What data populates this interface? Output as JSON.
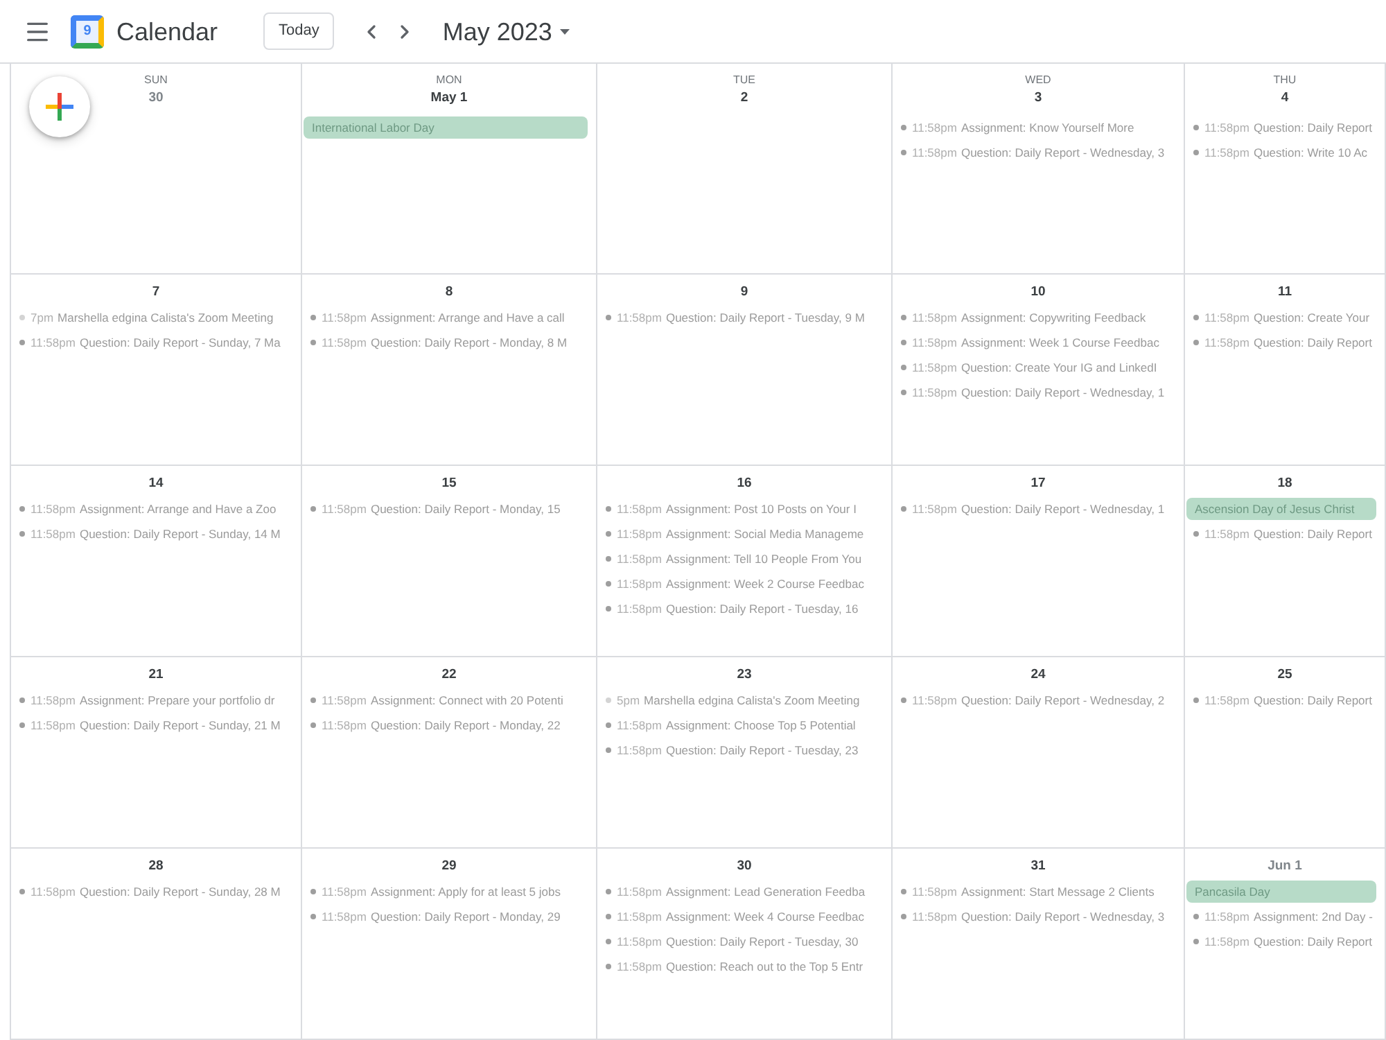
{
  "header": {
    "app_name": "Calendar",
    "logo_text": "9",
    "today_button": "Today",
    "period": "May 2023"
  },
  "weekdays": [
    "SUN",
    "MON",
    "TUE",
    "WED",
    "THU"
  ],
  "weeks": [
    {
      "days": [
        {
          "date": "30",
          "in_month": false
        },
        {
          "date": "May 1",
          "in_month": true,
          "events": [
            {
              "kind": "all_day",
              "title": "International Labor Day"
            }
          ]
        },
        {
          "date": "2",
          "in_month": true
        },
        {
          "date": "3",
          "in_month": true,
          "events": [
            {
              "kind": "timed",
              "time": "11:58pm",
              "title": "Assignment: Know Yourself More",
              "color": "#9e9e9e"
            },
            {
              "kind": "timed",
              "time": "11:58pm",
              "title": "Question: Daily Report - Wednesday, 3",
              "color": "#9e9e9e"
            }
          ]
        },
        {
          "date": "4",
          "in_month": true,
          "events": [
            {
              "kind": "timed",
              "time": "11:58pm",
              "title": "Question: Daily Report",
              "color": "#9e9e9e"
            },
            {
              "kind": "timed",
              "time": "11:58pm",
              "title": "Question: Write 10 Ac",
              "color": "#9e9e9e"
            }
          ]
        }
      ]
    },
    {
      "days": [
        {
          "date": "7",
          "in_month": true,
          "events": [
            {
              "kind": "timed",
              "time": "7pm",
              "title": "Marshella edgina Calista's Zoom Meeting",
              "color": "#d4d4d4"
            },
            {
              "kind": "timed",
              "time": "11:58pm",
              "title": "Question: Daily Report - Sunday, 7 Ma",
              "color": "#9e9e9e"
            }
          ]
        },
        {
          "date": "8",
          "in_month": true,
          "events": [
            {
              "kind": "timed",
              "time": "11:58pm",
              "title": "Assignment: Arrange and Have a call",
              "color": "#9e9e9e"
            },
            {
              "kind": "timed",
              "time": "11:58pm",
              "title": "Question: Daily Report - Monday, 8 M",
              "color": "#9e9e9e"
            }
          ]
        },
        {
          "date": "9",
          "in_month": true,
          "events": [
            {
              "kind": "timed",
              "time": "11:58pm",
              "title": "Question: Daily Report - Tuesday, 9 M",
              "color": "#9e9e9e"
            }
          ]
        },
        {
          "date": "10",
          "in_month": true,
          "events": [
            {
              "kind": "timed",
              "time": "11:58pm",
              "title": "Assignment: Copywriting Feedback",
              "color": "#9e9e9e"
            },
            {
              "kind": "timed",
              "time": "11:58pm",
              "title": "Assignment: Week 1 Course Feedbac",
              "color": "#9e9e9e"
            },
            {
              "kind": "timed",
              "time": "11:58pm",
              "title": "Question: Create Your IG and LinkedI",
              "color": "#9e9e9e"
            },
            {
              "kind": "timed",
              "time": "11:58pm",
              "title": "Question: Daily Report - Wednesday, 1",
              "color": "#9e9e9e"
            }
          ]
        },
        {
          "date": "11",
          "in_month": true,
          "events": [
            {
              "kind": "timed",
              "time": "11:58pm",
              "title": "Question: Create Your",
              "color": "#9e9e9e"
            },
            {
              "kind": "timed",
              "time": "11:58pm",
              "title": "Question: Daily Report",
              "color": "#9e9e9e"
            }
          ]
        }
      ]
    },
    {
      "days": [
        {
          "date": "14",
          "in_month": true,
          "events": [
            {
              "kind": "timed",
              "time": "11:58pm",
              "title": "Assignment: Arrange and Have a Zoo",
              "color": "#9e9e9e"
            },
            {
              "kind": "timed",
              "time": "11:58pm",
              "title": "Question: Daily Report - Sunday, 14 M",
              "color": "#9e9e9e"
            }
          ]
        },
        {
          "date": "15",
          "in_month": true,
          "events": [
            {
              "kind": "timed",
              "time": "11:58pm",
              "title": "Question: Daily Report - Monday, 15",
              "color": "#9e9e9e"
            }
          ]
        },
        {
          "date": "16",
          "in_month": true,
          "events": [
            {
              "kind": "timed",
              "time": "11:58pm",
              "title": "Assignment: Post 10 Posts on Your I",
              "color": "#9e9e9e"
            },
            {
              "kind": "timed",
              "time": "11:58pm",
              "title": "Assignment: Social Media Manageme",
              "color": "#9e9e9e"
            },
            {
              "kind": "timed",
              "time": "11:58pm",
              "title": "Assignment: Tell 10 People From You",
              "color": "#9e9e9e"
            },
            {
              "kind": "timed",
              "time": "11:58pm",
              "title": "Assignment: Week 2 Course Feedbac",
              "color": "#9e9e9e"
            },
            {
              "kind": "timed",
              "time": "11:58pm",
              "title": "Question: Daily Report - Tuesday, 16",
              "color": "#9e9e9e"
            }
          ]
        },
        {
          "date": "17",
          "in_month": true,
          "events": [
            {
              "kind": "timed",
              "time": "11:58pm",
              "title": "Question: Daily Report - Wednesday, 1",
              "color": "#9e9e9e"
            }
          ]
        },
        {
          "date": "18",
          "in_month": true,
          "events": [
            {
              "kind": "all_day",
              "title": "Ascension Day of Jesus Christ"
            },
            {
              "kind": "timed",
              "time": "11:58pm",
              "title": "Question: Daily Report",
              "color": "#9e9e9e"
            }
          ]
        }
      ]
    },
    {
      "days": [
        {
          "date": "21",
          "in_month": true,
          "events": [
            {
              "kind": "timed",
              "time": "11:58pm",
              "title": "Assignment: Prepare your portfolio dr",
              "color": "#9e9e9e"
            },
            {
              "kind": "timed",
              "time": "11:58pm",
              "title": "Question: Daily Report - Sunday, 21 M",
              "color": "#9e9e9e"
            }
          ]
        },
        {
          "date": "22",
          "in_month": true,
          "events": [
            {
              "kind": "timed",
              "time": "11:58pm",
              "title": "Assignment: Connect with 20 Potenti",
              "color": "#9e9e9e"
            },
            {
              "kind": "timed",
              "time": "11:58pm",
              "title": "Question: Daily Report - Monday, 22",
              "color": "#9e9e9e"
            }
          ]
        },
        {
          "date": "23",
          "in_month": true,
          "events": [
            {
              "kind": "timed",
              "time": "5pm",
              "title": "Marshella edgina Calista's Zoom Meeting",
              "color": "#d4d4d4"
            },
            {
              "kind": "timed",
              "time": "11:58pm",
              "title": "Assignment: Choose Top 5 Potential",
              "color": "#9e9e9e"
            },
            {
              "kind": "timed",
              "time": "11:58pm",
              "title": "Question: Daily Report - Tuesday, 23",
              "color": "#9e9e9e"
            }
          ]
        },
        {
          "date": "24",
          "in_month": true,
          "events": [
            {
              "kind": "timed",
              "time": "11:58pm",
              "title": "Question: Daily Report - Wednesday, 2",
              "color": "#9e9e9e"
            }
          ]
        },
        {
          "date": "25",
          "in_month": true,
          "events": [
            {
              "kind": "timed",
              "time": "11:58pm",
              "title": "Question: Daily Report",
              "color": "#9e9e9e"
            }
          ]
        }
      ]
    },
    {
      "days": [
        {
          "date": "28",
          "in_month": true,
          "events": [
            {
              "kind": "timed",
              "time": "11:58pm",
              "title": "Question: Daily Report - Sunday, 28 M",
              "color": "#9e9e9e"
            }
          ]
        },
        {
          "date": "29",
          "in_month": true,
          "events": [
            {
              "kind": "timed",
              "time": "11:58pm",
              "title": "Assignment: Apply for at least 5 jobs",
              "color": "#9e9e9e"
            },
            {
              "kind": "timed",
              "time": "11:58pm",
              "title": "Question: Daily Report - Monday, 29",
              "color": "#9e9e9e"
            }
          ]
        },
        {
          "date": "30",
          "in_month": true,
          "events": [
            {
              "kind": "timed",
              "time": "11:58pm",
              "title": "Assignment: Lead Generation Feedba",
              "color": "#9e9e9e"
            },
            {
              "kind": "timed",
              "time": "11:58pm",
              "title": "Assignment: Week 4 Course Feedbac",
              "color": "#9e9e9e"
            },
            {
              "kind": "timed",
              "time": "11:58pm",
              "title": "Question: Daily Report - Tuesday, 30",
              "color": "#9e9e9e"
            },
            {
              "kind": "timed",
              "time": "11:58pm",
              "title": "Question: Reach out to the Top 5 Entr",
              "color": "#9e9e9e"
            }
          ]
        },
        {
          "date": "31",
          "in_month": true,
          "events": [
            {
              "kind": "timed",
              "time": "11:58pm",
              "title": "Assignment: Start Message 2 Clients",
              "color": "#9e9e9e"
            },
            {
              "kind": "timed",
              "time": "11:58pm",
              "title": "Question: Daily Report - Wednesday, 3",
              "color": "#9e9e9e"
            }
          ]
        },
        {
          "date": "Jun 1",
          "in_month": false,
          "events": [
            {
              "kind": "all_day",
              "title": "Pancasila Day"
            },
            {
              "kind": "timed",
              "time": "11:58pm",
              "title": "Assignment: 2nd Day -",
              "color": "#9e9e9e"
            },
            {
              "kind": "timed",
              "time": "11:58pm",
              "title": "Question: Daily Report",
              "color": "#9e9e9e"
            }
          ]
        }
      ]
    }
  ]
}
